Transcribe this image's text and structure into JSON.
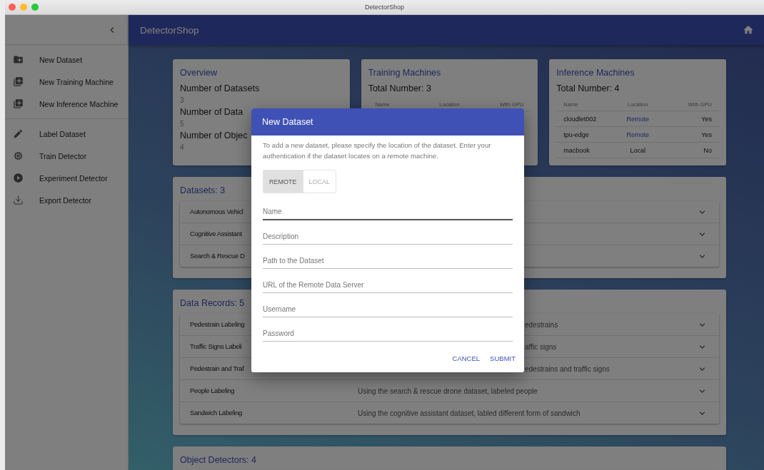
{
  "window": {
    "title": "DetectorShop"
  },
  "sidebar": {
    "items": [
      {
        "label": "New Dataset"
      },
      {
        "label": "New Training Machine"
      },
      {
        "label": "New Inference Machine"
      },
      {
        "label": "Label Dataset"
      },
      {
        "label": "Train Detector"
      },
      {
        "label": "Experiment Detector"
      },
      {
        "label": "Export Detector"
      }
    ]
  },
  "app_bar": {
    "title": "DetectorShop"
  },
  "overview": {
    "title": "Overview",
    "stats": [
      {
        "label": "Number of Datasets",
        "value": "3"
      },
      {
        "label": "Number of Data",
        "value": "5"
      },
      {
        "label": "Number of Objec",
        "value": "4"
      }
    ]
  },
  "training_machines": {
    "title": "Training Machines",
    "total": "Total Number: 3",
    "columns": [
      "Name",
      "Location",
      "With GPU"
    ]
  },
  "inference_machines": {
    "title": "Inference Machines",
    "total": "Total Number: 4",
    "columns": [
      "Name",
      "Location",
      "With GPU"
    ],
    "rows": [
      {
        "name": "cloudlet002",
        "location": "Remote",
        "link": true,
        "gpu": "Yes"
      },
      {
        "name": "tpu-edge",
        "location": "Remote",
        "link": true,
        "gpu": "Yes"
      },
      {
        "name": "macbook",
        "location": "Local",
        "link": false,
        "gpu": "No"
      }
    ]
  },
  "datasets": {
    "title": "Datasets: 3",
    "rows": [
      {
        "name": "Autonomous Vehicl"
      },
      {
        "name": "Cognitive Assistant"
      },
      {
        "name": "Search & Rescue D"
      }
    ]
  },
  "data_records": {
    "title": "Data Records: 5",
    "rows": [
      {
        "kind": "partial",
        "name": "Pedestrain Labeling",
        "description": "edestrains"
      },
      {
        "kind": "partial",
        "name": "Traffic Signs Labeli",
        "description": "affic signs"
      },
      {
        "kind": "partial",
        "name": "Pedestrain and Traf",
        "description": "edestrains and traffic signs"
      },
      {
        "kind": "full",
        "name": "People Labeling",
        "description": "Using the search & rescue drone dataset, labeled people"
      },
      {
        "kind": "full",
        "name": "Sandwich Labeling",
        "description": "Using the cognitive assistant dataset, labled different form of sandwich"
      }
    ]
  },
  "object_detectors": {
    "title": "Object Detectors: 4"
  },
  "dialog": {
    "title": "New Dataset",
    "text": "To add a new dataset, please specify the location of the dataset. Enter your authentication if the dataset locates on a remote machine.",
    "toggle": [
      {
        "label": "REMOTE",
        "selected": true
      },
      {
        "label": "LOCAL",
        "selected": false
      }
    ],
    "fields": [
      {
        "placeholder": "Name",
        "focused": true
      },
      {
        "placeholder": "Description",
        "focused": false
      },
      {
        "placeholder": "Path to the Dataset",
        "focused": false
      },
      {
        "placeholder": "URL of the Remote Data Server",
        "focused": false
      },
      {
        "placeholder": "Username",
        "focused": false
      },
      {
        "placeholder": "Password",
        "focused": false
      }
    ],
    "buttons": [
      "CANCEL",
      "SUBMIT"
    ]
  }
}
